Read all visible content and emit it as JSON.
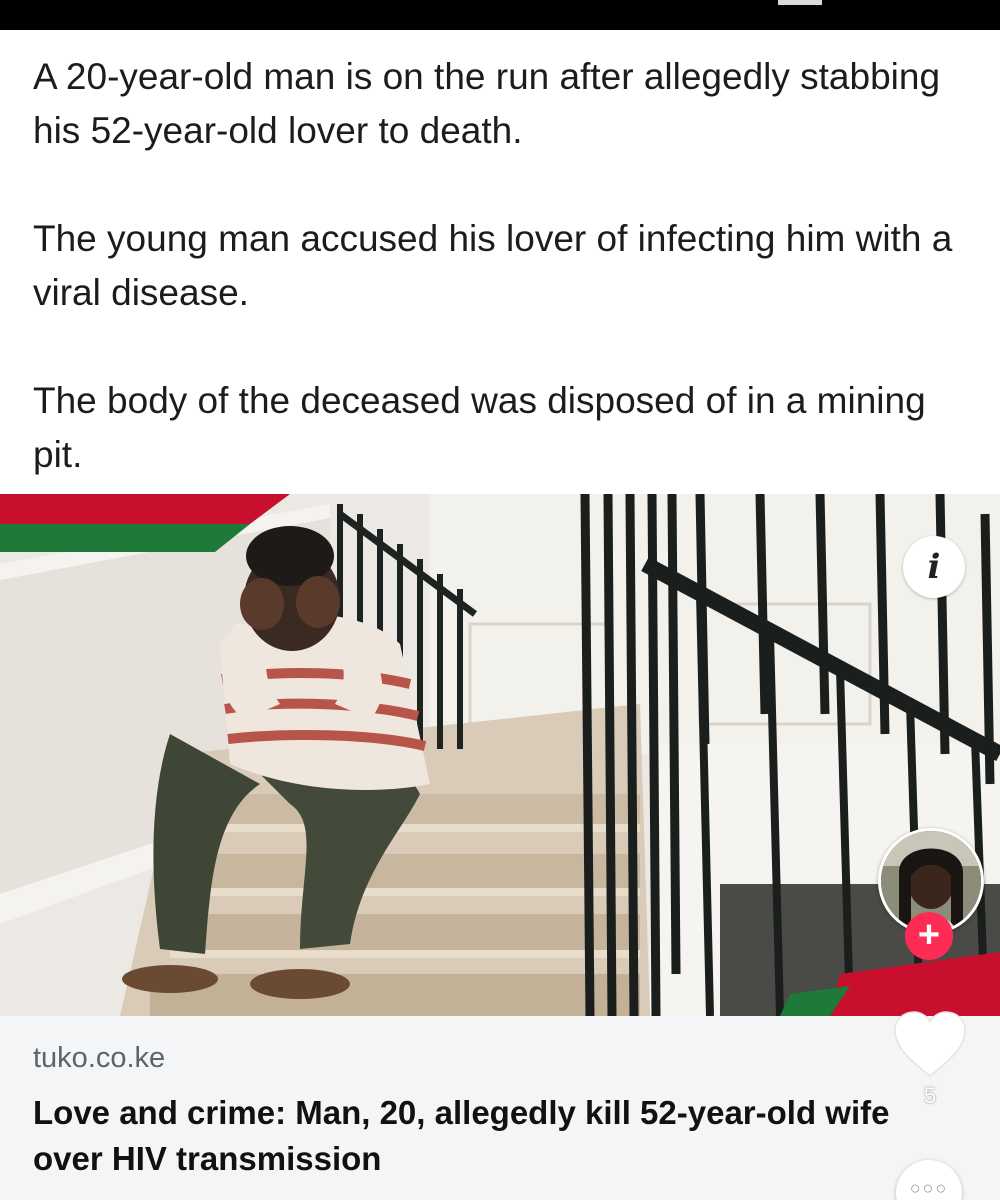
{
  "post": {
    "paragraphs": [
      "A 20-year-old man is on the run after allegedly stabbing his 52-year-old  lover to death.",
      "The young man accused his lover of infecting him with a viral disease.",
      "The body of the deceased was disposed of in a mining pit."
    ]
  },
  "link_preview": {
    "image": {
      "info_icon": "info-icon",
      "info_glyph": "i"
    },
    "domain": "tuko.co.ke",
    "headline": "Love and crime: Man, 20, allegedly kill 52-year-old wife over HIV transmission"
  },
  "action_rail": {
    "follow_glyph": "+",
    "like_icon": "heart-icon",
    "like_count": "5",
    "more_icon": "more-icon",
    "more_glyph": "○○○"
  },
  "colors": {
    "brand_red": "#c8102e",
    "brand_green": "#1f7a3a",
    "follow_pink": "#fe2c55"
  }
}
